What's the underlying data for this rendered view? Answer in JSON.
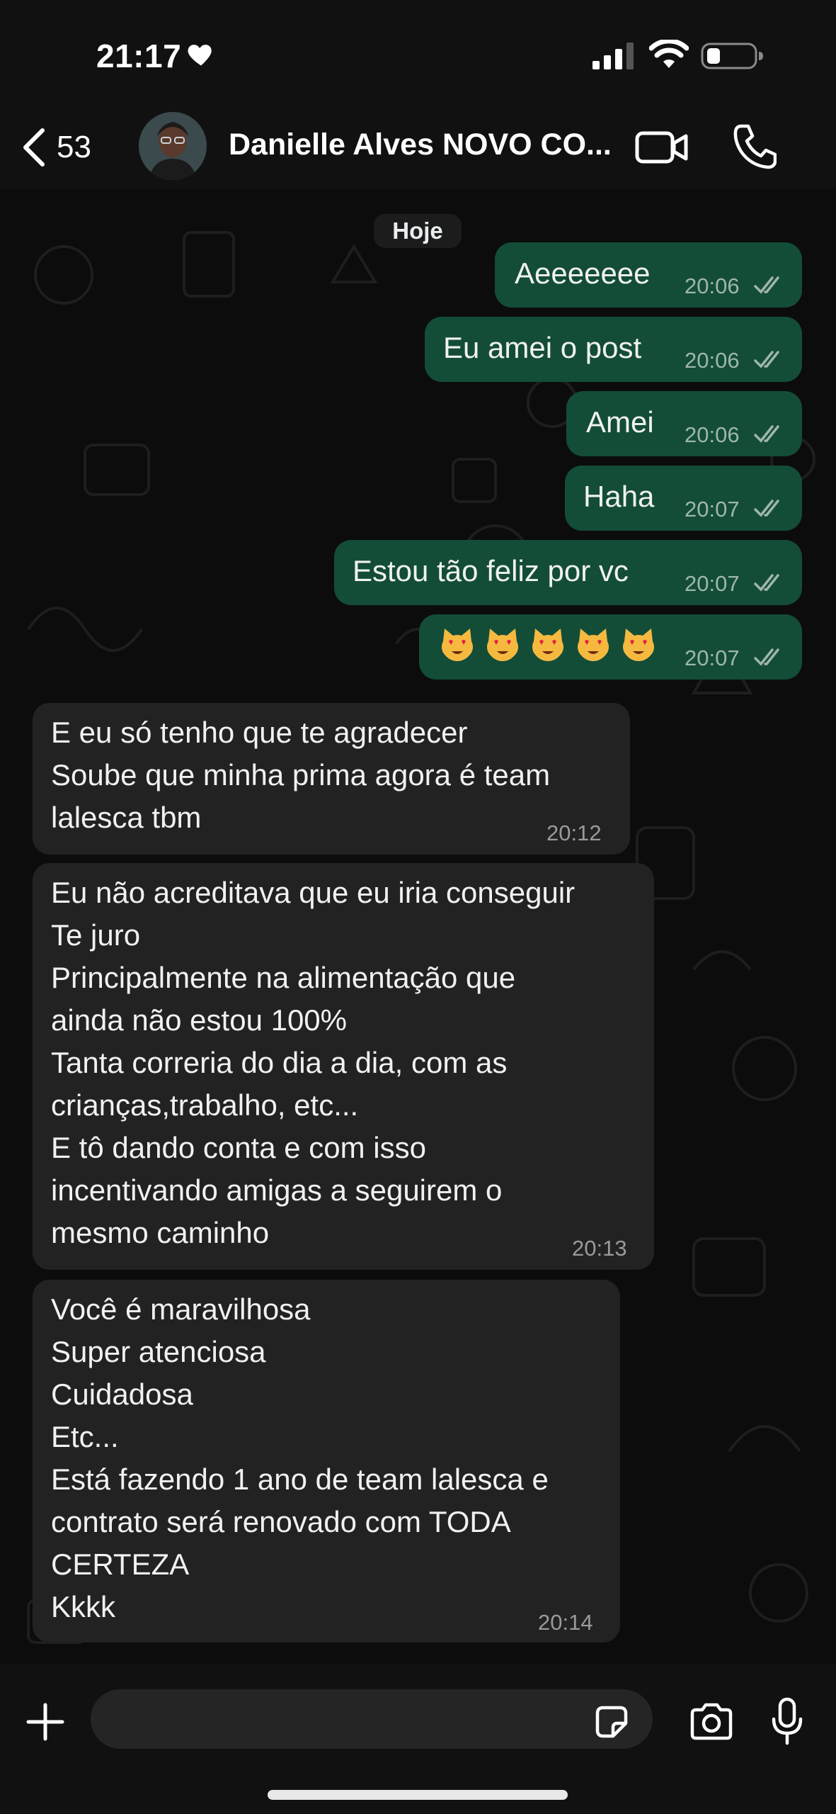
{
  "status_bar": {
    "time": "21:17",
    "icons": [
      "heart-icon",
      "signal-icon",
      "wifi-icon",
      "battery-icon"
    ]
  },
  "header": {
    "back_count": "53",
    "contact_name": "Danielle Alves NOVO CO...",
    "icons": [
      "chevron-left-icon",
      "video-call-icon",
      "phone-icon"
    ]
  },
  "chat": {
    "date_chip": "Hoje",
    "messages": [
      {
        "direction": "out",
        "text": "Aeeeeeee",
        "time": "20:06",
        "status": "read"
      },
      {
        "direction": "out",
        "text": "Eu amei o post",
        "time": "20:06",
        "status": "read"
      },
      {
        "direction": "out",
        "text": "Amei",
        "time": "20:06",
        "status": "read"
      },
      {
        "direction": "out",
        "text": "Haha",
        "time": "20:07",
        "status": "read"
      },
      {
        "direction": "out",
        "text": "Estou tão feliz por vc",
        "time": "20:07",
        "status": "read"
      },
      {
        "direction": "out",
        "text": "😻😻😻😻😻",
        "time": "20:07",
        "status": "read"
      },
      {
        "direction": "in",
        "text": "E eu só tenho que te agradecer\nSoube que minha prima agora é team\nlalesca tbm",
        "time": "20:12"
      },
      {
        "direction": "in",
        "text": "Eu não acreditava que eu iria conseguir\nTe juro\nPrincipalmente na alimentação que\nainda não estou 100%\nTanta correria do dia a dia, com as\ncrianças,trabalho, etc...\nE tô dando conta e com isso\nincentivando amigas a seguirem o\nmesmo caminho",
        "time": "20:13"
      },
      {
        "direction": "in",
        "text": "Você é maravilhosa\nSuper atenciosa\nCuidadosa\nEtc...\nEstá fazendo 1 ano de team lalesca e\ncontrato será renovado com TODA\nCERTEZA\nKkkk",
        "time": "20:14"
      }
    ]
  },
  "input_bar": {
    "placeholder": "",
    "icons": [
      "plus-icon",
      "sticker-icon",
      "camera-icon",
      "microphone-icon"
    ]
  },
  "colors": {
    "outgoing_bubble": "#134d37",
    "incoming_bubble": "#222222",
    "background": "#0c0c0c",
    "read_ticks": "#9eb6ab"
  }
}
